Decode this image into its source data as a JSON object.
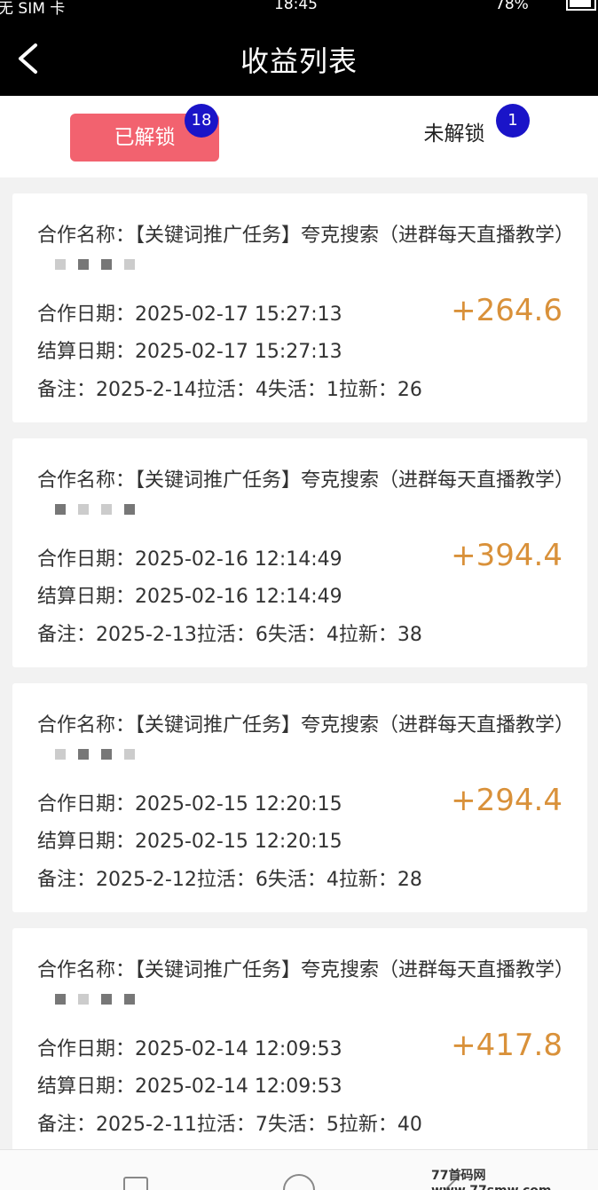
{
  "status_bar": {
    "carrier": "无 SIM 卡",
    "time": "18:45",
    "battery": "78%",
    "battery_level": 0.78
  },
  "header": {
    "title": "收益列表"
  },
  "tabs": [
    {
      "label": "已解锁",
      "badge": "18"
    },
    {
      "label": "未解锁",
      "badge": "1"
    }
  ],
  "records": [
    {
      "name": "合作名称：【关键词推广任务】夸克搜索（进群每天直播教学）",
      "date": "合作日期：2025-02-17 15:27:13",
      "settle": "结算日期：2025-02-17 15:27:13",
      "note": "备注：2025-2-14拉活：4失活：1拉新：26",
      "amount": "+264.6"
    },
    {
      "name": "合作名称：【关键词推广任务】夸克搜索（进群每天直播教学）",
      "date": "合作日期：2025-02-16 12:14:49",
      "settle": "结算日期：2025-02-16 12:14:49",
      "note": "备注：2025-2-13拉活：6失活：4拉新：38",
      "amount": "+394.4"
    },
    {
      "name": "合作名称：【关键词推广任务】夸克搜索（进群每天直播教学）",
      "date": "合作日期：2025-02-15 12:20:15",
      "settle": "结算日期：2025-02-15 12:20:15",
      "note": "备注：2025-2-12拉活：6失活：4拉新：28",
      "amount": "+294.4"
    },
    {
      "name": "合作名称：【关键词推广任务】夸克搜索（进群每天直播教学）",
      "date": "合作日期：2025-02-14 12:09:53",
      "settle": "结算日期：2025-02-14 12:09:53",
      "note": "备注：2025-2-11拉活：7失活：5拉新：40",
      "amount": "+417.8"
    }
  ],
  "watermark": "77首码网 www.77smw.com",
  "colors": {
    "accent": "#f2626f",
    "badge": "#1a14c8",
    "amount": "#d9913a",
    "header_bg": "#000000"
  },
  "icons": [
    "back-arrow-icon",
    "wifi-icon",
    "lock-rotation-icon",
    "battery-icon",
    "nav-recent-icon",
    "nav-home-icon",
    "nav-back-icon"
  ]
}
